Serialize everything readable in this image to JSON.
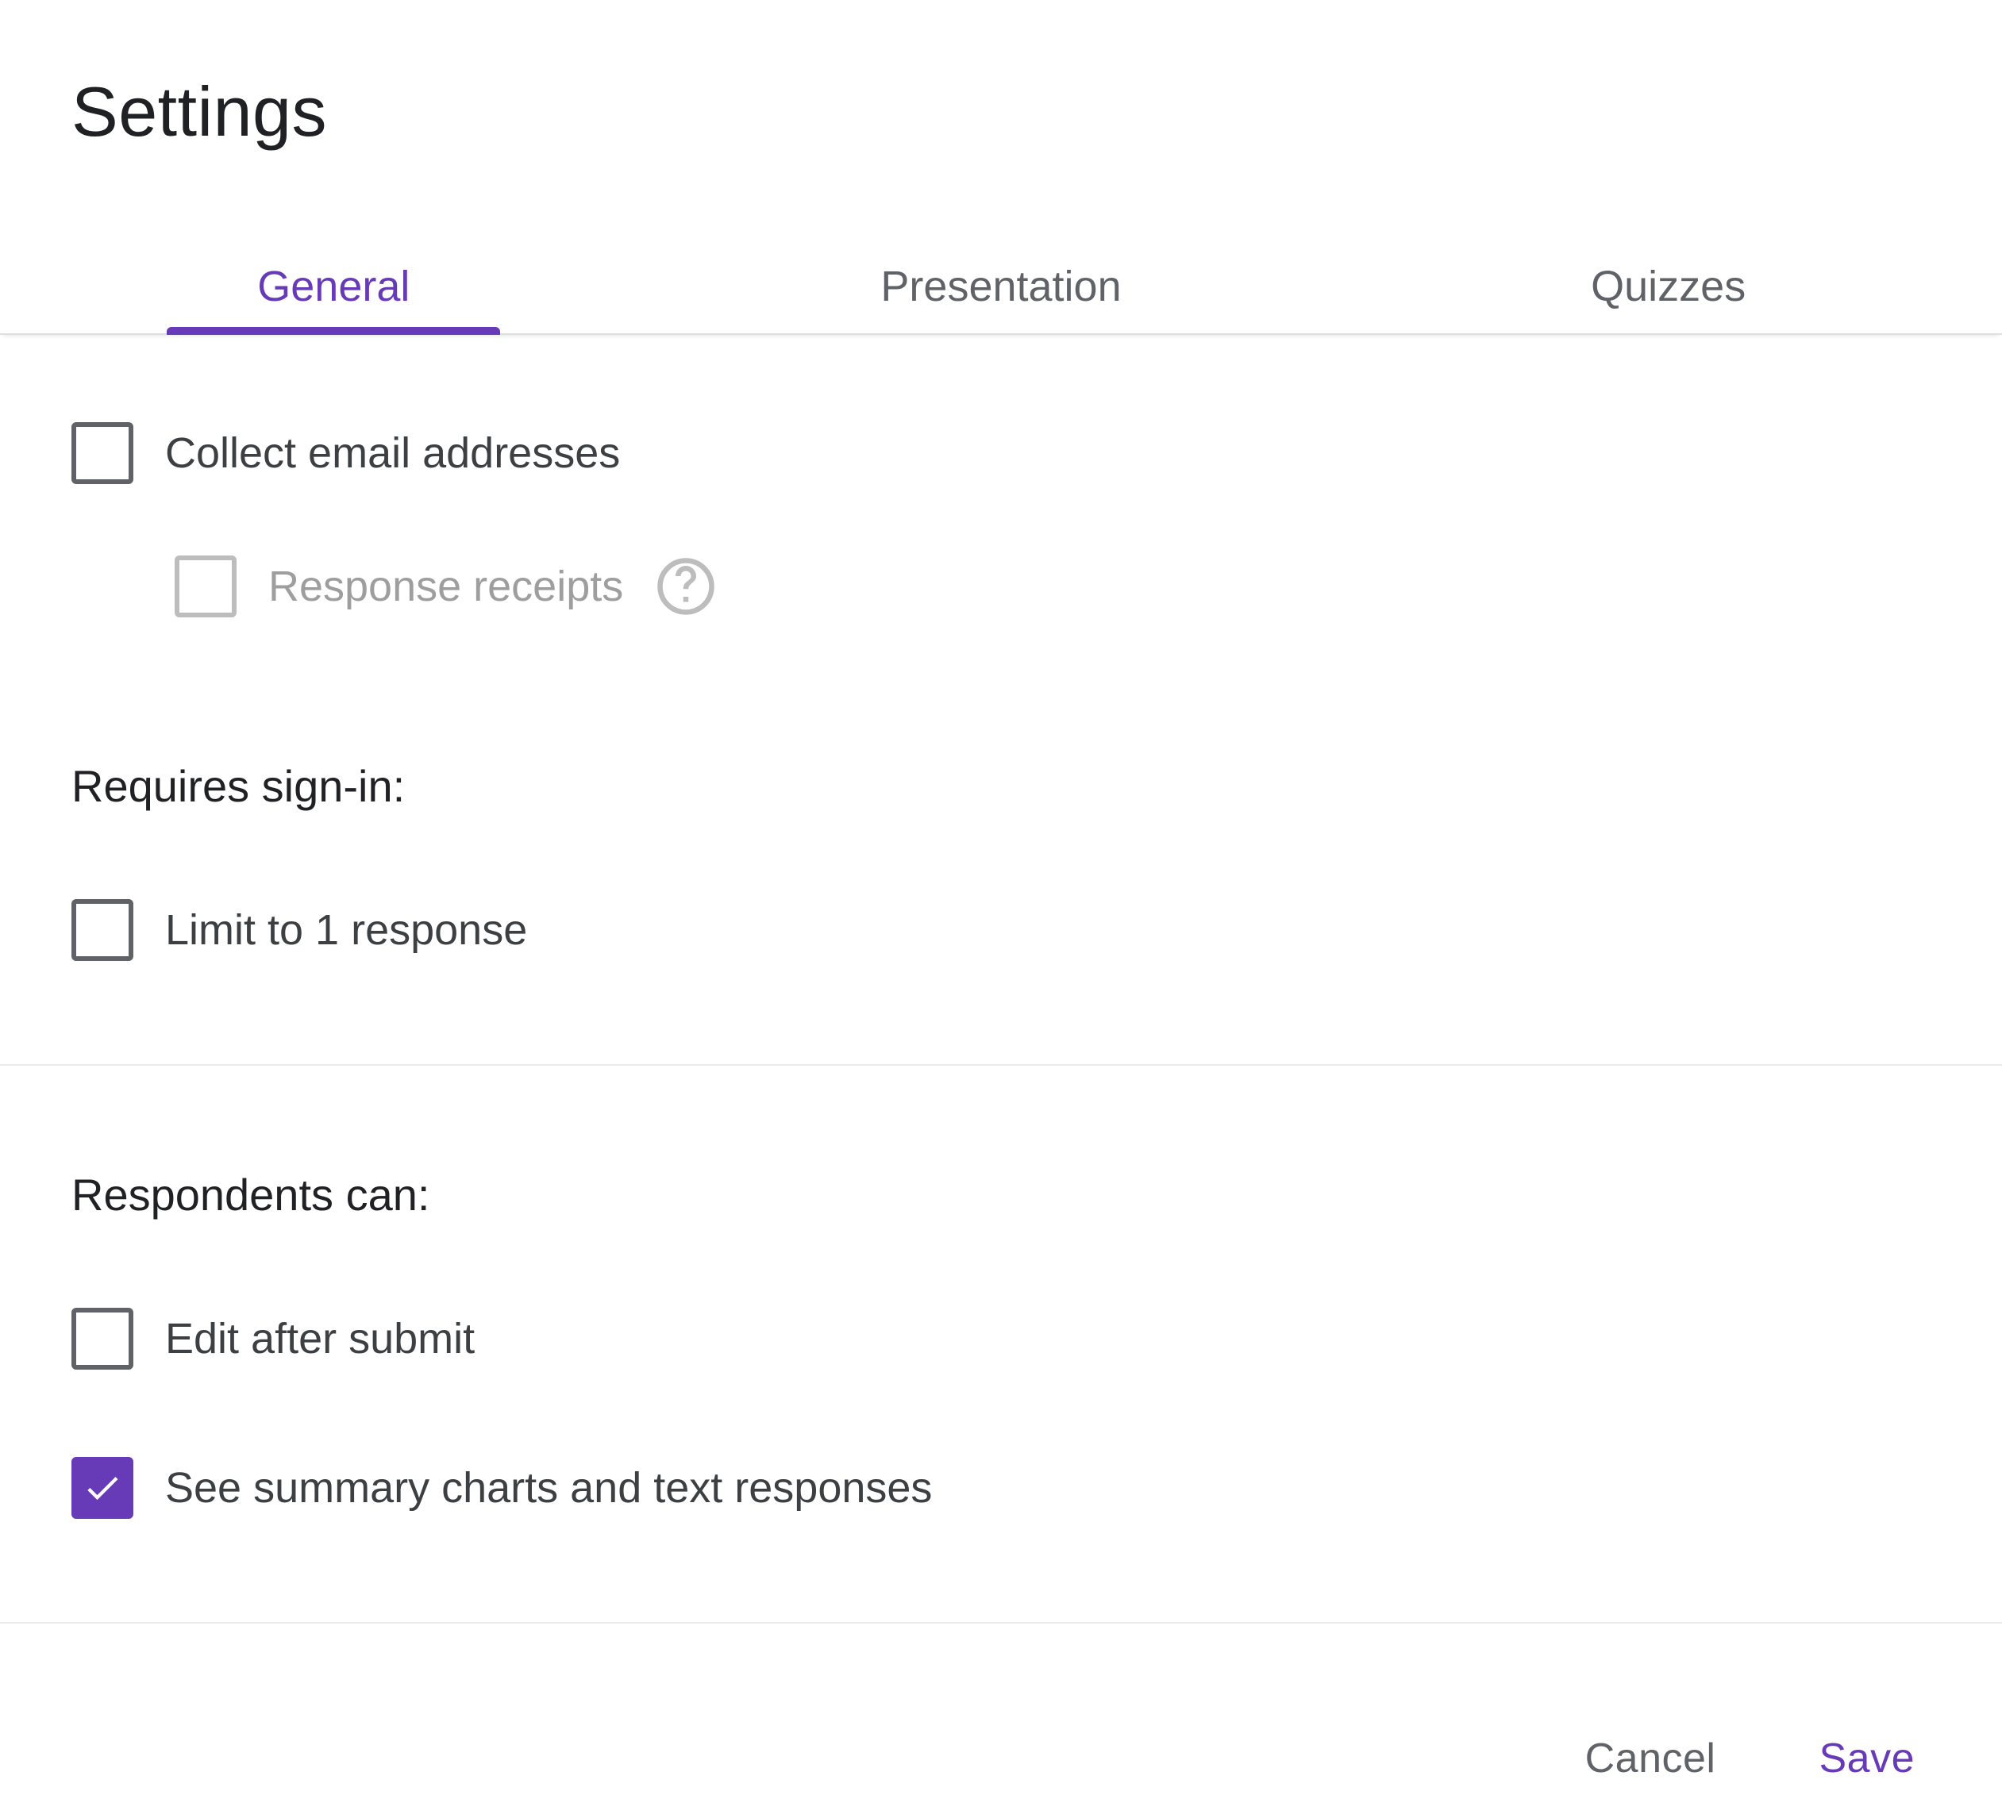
{
  "colors": {
    "accent": "#673ab7"
  },
  "title": "Settings",
  "tabs": [
    {
      "label": "General",
      "active": true
    },
    {
      "label": "Presentation",
      "active": false
    },
    {
      "label": "Quizzes",
      "active": false
    }
  ],
  "general": {
    "collect_email": {
      "label": "Collect email addresses",
      "checked": false
    },
    "response_receipts": {
      "label": "Response receipts",
      "checked": false,
      "disabled": true
    },
    "requires_signin_heading": "Requires sign-in:",
    "limit_one": {
      "label": "Limit to 1 response",
      "checked": false
    },
    "respondents_can_heading": "Respondents can:",
    "edit_after_submit": {
      "label": "Edit after submit",
      "checked": false
    },
    "see_summary": {
      "label": "See summary charts and text responses",
      "checked": true
    }
  },
  "footer": {
    "cancel": "Cancel",
    "save": "Save"
  }
}
